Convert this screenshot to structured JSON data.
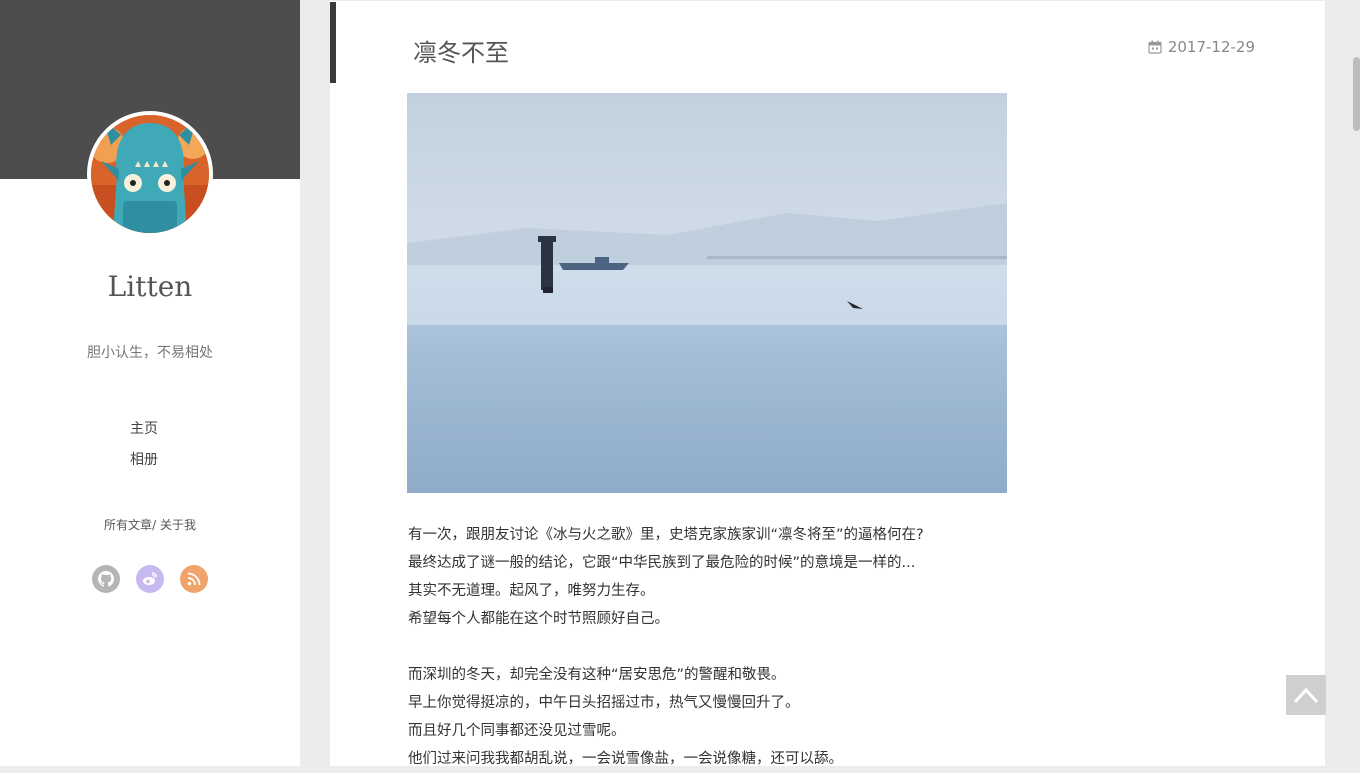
{
  "sidebar": {
    "author": "Litten",
    "motto": "胆小认生，不易相处",
    "nav": [
      "主页",
      "相册"
    ],
    "links": {
      "all_posts": "所有文章",
      "sep": "/",
      "about": "关于我"
    },
    "social": [
      {
        "icon": "github-icon",
        "color": "#b5b5b5"
      },
      {
        "icon": "weibo-icon",
        "color": "#c8b8f0"
      },
      {
        "icon": "rss-icon",
        "color": "#f0a36a"
      }
    ]
  },
  "post": {
    "title": "凛冬不至",
    "date": "2017-12-29",
    "paragraphs": [
      "有一次，跟朋友讨论《冰与火之歌》里，史塔克家族家训“凛冬将至”的逼格何在?",
      "最终达成了谜一般的结论，它跟“中华民族到了最危险的时候”的意境是一样的...",
      "其实不无道理。起风了，唯努力生存。",
      "希望每个人都能在这个时节照顾好自己。",
      "",
      "而深圳的冬天，却完全没有这种“居安思危”的警醒和敬畏。",
      "早上你觉得挺凉的，中午日头招摇过市，热气又慢慢回升了。",
      "而且好几个同事都还没见过雪呢。",
      "他们过来问我我都胡乱说，一会说雪像盐，一会说像糖，还可以舔。"
    ]
  },
  "colors": {
    "sidebar_header": "#4d4d4d",
    "accent_bar": "#3a3a3a",
    "back_to_top": "#cfcfcf"
  }
}
